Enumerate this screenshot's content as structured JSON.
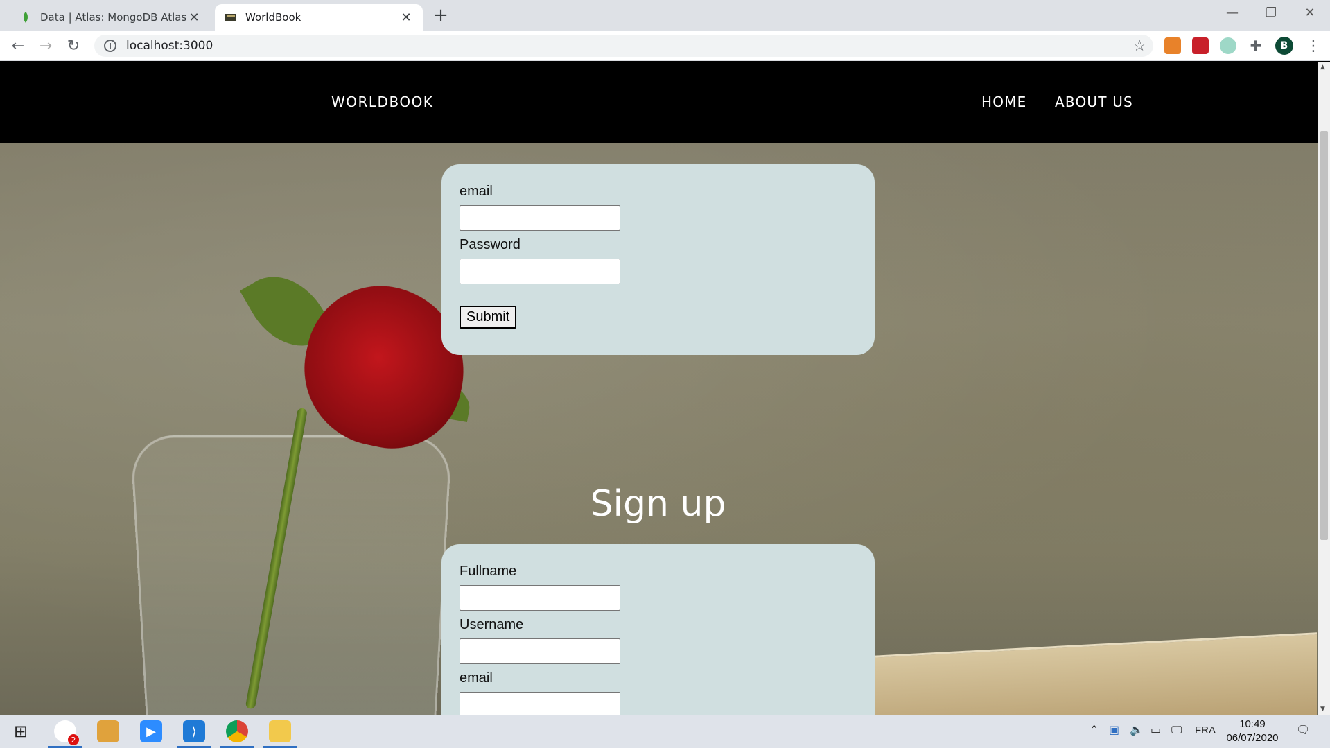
{
  "browser": {
    "tabs": [
      {
        "title": "Data | Atlas: MongoDB Atlas",
        "active": false,
        "favicon": "mongodb-leaf-icon"
      },
      {
        "title": "WorldBook",
        "active": true,
        "favicon": "book-icon"
      }
    ],
    "url": "localhost:3000",
    "profile_initial": "B"
  },
  "site": {
    "brand": "WORLDBOOK",
    "nav": [
      {
        "label": "HOME"
      },
      {
        "label": "ABOUT US"
      }
    ]
  },
  "login": {
    "fields": [
      {
        "label": "email"
      },
      {
        "label": "Password"
      }
    ],
    "submit_label": "Submit"
  },
  "signup": {
    "title": "Sign up",
    "fields": [
      {
        "label": "Fullname"
      },
      {
        "label": "Username"
      },
      {
        "label": "email"
      }
    ]
  },
  "taskbar": {
    "notification_badge": "2",
    "language": "FRA",
    "time": "10:49",
    "date": "06/07/2020"
  },
  "colors": {
    "navbar": "#000000",
    "card": "#d0dfe0",
    "accent": "#2f6fc2"
  }
}
